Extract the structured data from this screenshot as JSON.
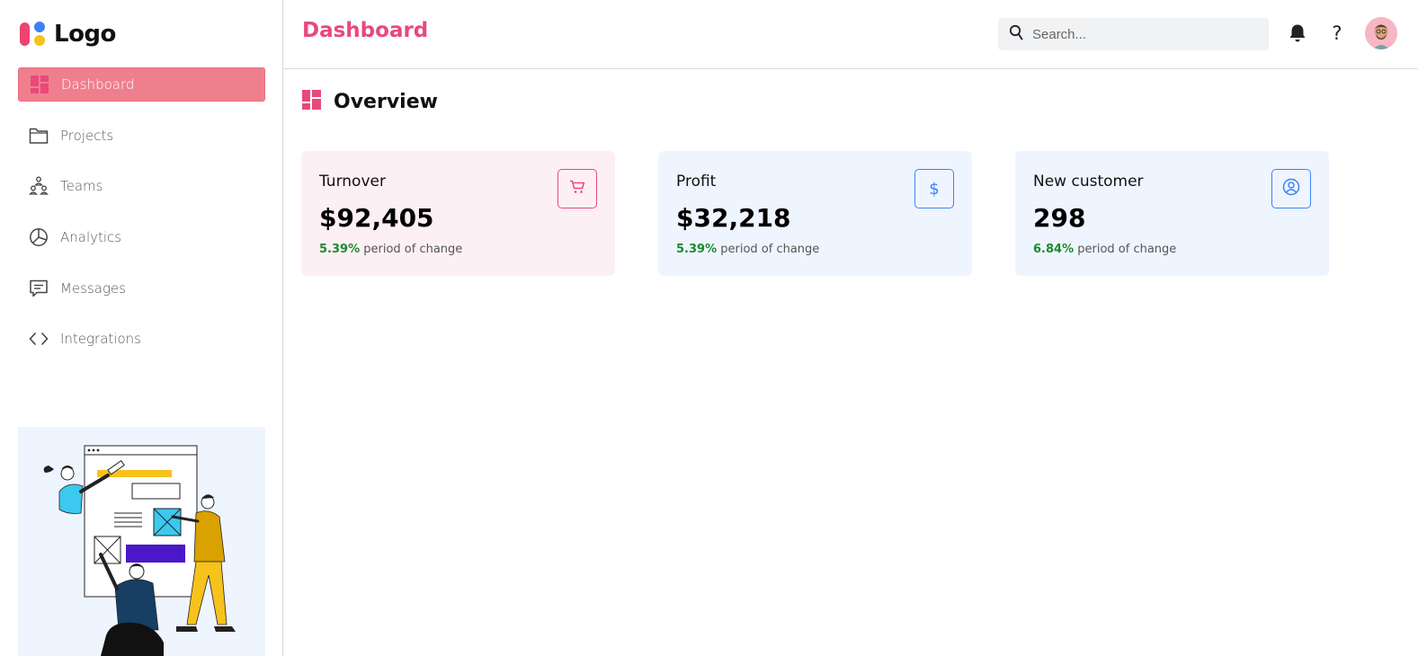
{
  "brand": {
    "name": "Logo"
  },
  "sidebar": {
    "items": [
      {
        "label": "Dashboard",
        "icon": "dashboard-icon",
        "active": true
      },
      {
        "label": "Projects",
        "icon": "folder-icon"
      },
      {
        "label": "Teams",
        "icon": "teams-icon"
      },
      {
        "label": "Analytics",
        "icon": "pie-chart-icon"
      },
      {
        "label": "Messages",
        "icon": "message-icon"
      },
      {
        "label": "Integrations",
        "icon": "code-icon"
      }
    ]
  },
  "header": {
    "title": "Dashboard",
    "search_placeholder": "Search..."
  },
  "main": {
    "overview_title": "Overview",
    "cards": [
      {
        "title": "Turnover",
        "value": "$92,405",
        "change_pct": "5.39%",
        "change_text": "period of change",
        "icon": "cart-icon",
        "tone": "pink"
      },
      {
        "title": "Profit",
        "value": "$32,218",
        "change_pct": "5.39%",
        "change_text": "period of change",
        "icon": "dollar-icon",
        "tone": "blue"
      },
      {
        "title": "New customer",
        "value": "298",
        "change_pct": "6.84%",
        "change_text": "period of change",
        "icon": "user-circle-icon",
        "tone": "blue"
      }
    ]
  },
  "colors": {
    "accent": "#e8497b",
    "active_nav": "#f07f8e",
    "positive": "#1c8a2f",
    "blue": "#3b82f6"
  }
}
